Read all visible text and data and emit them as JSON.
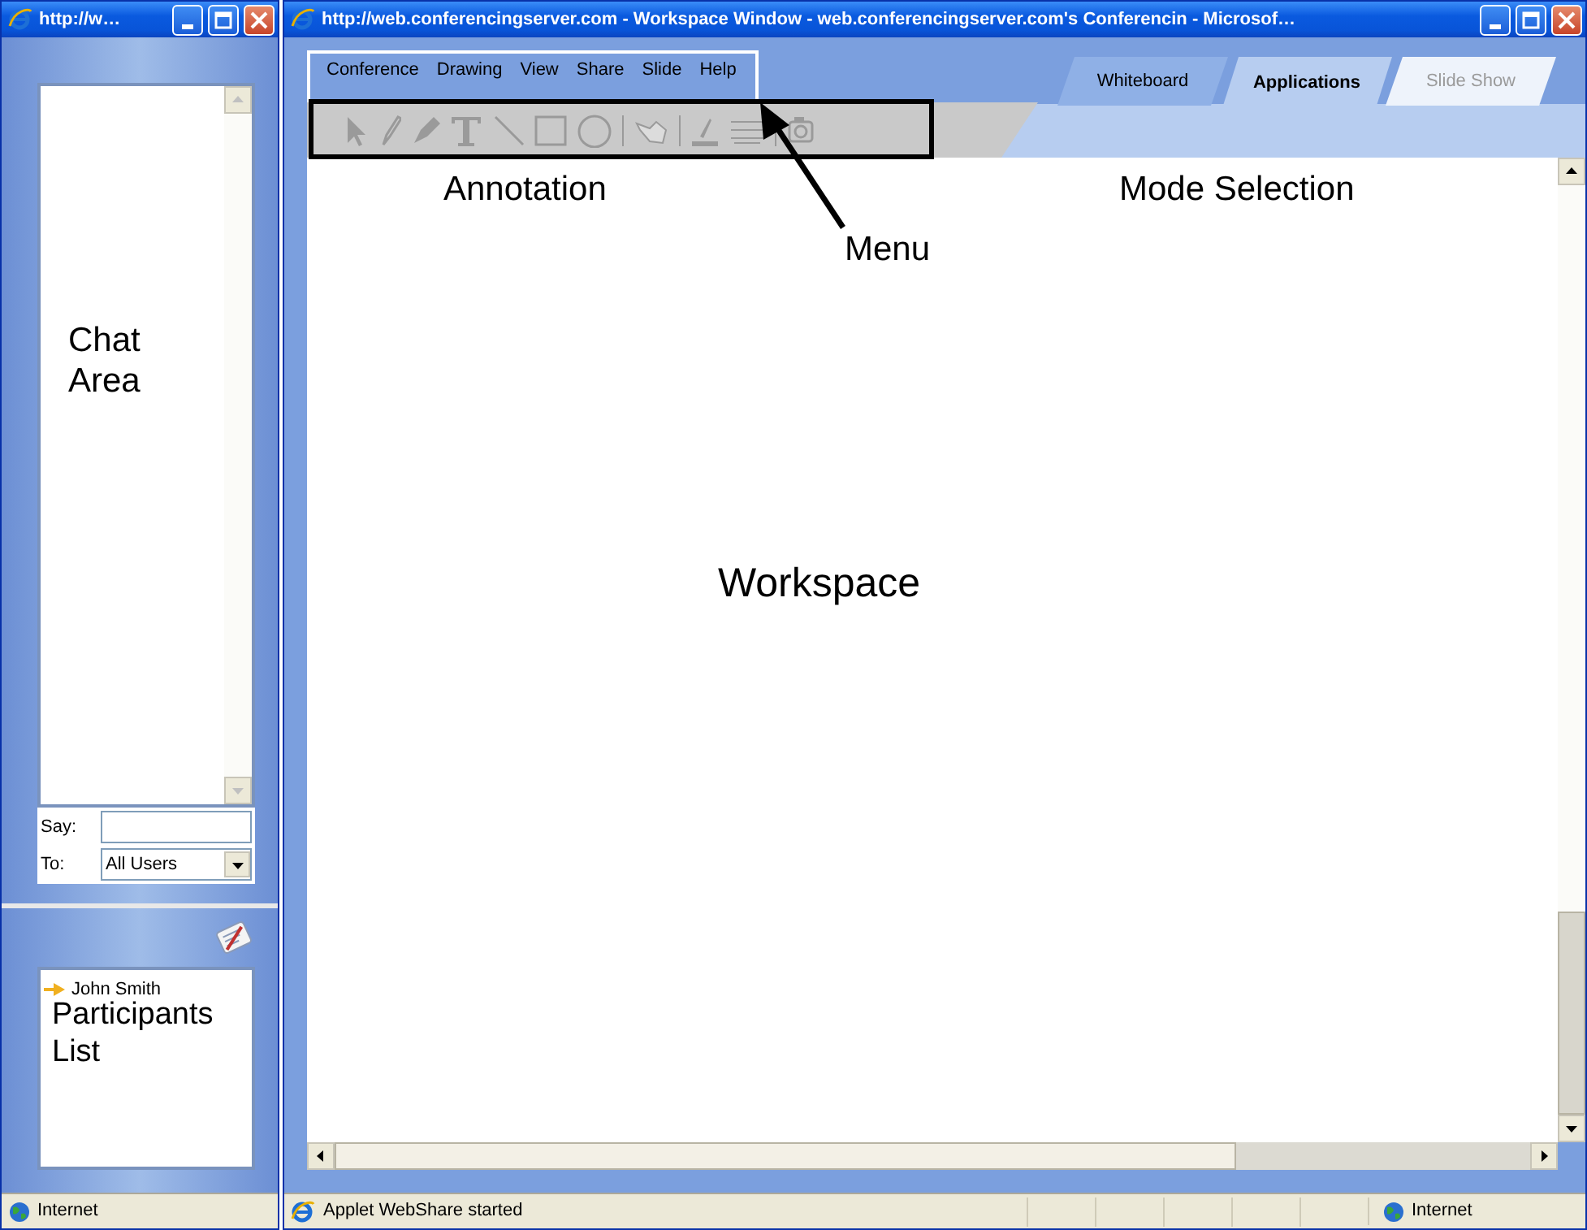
{
  "chat_window": {
    "title": "http://w…",
    "say_label": "Say:",
    "to_label": "To:",
    "to_value": "All Users",
    "participants": [
      {
        "name": "John Smith"
      }
    ],
    "status": "Internet"
  },
  "workspace_window": {
    "title": "http://web.conferencingserver.com - Workspace Window - web.conferencingserver.com's Conferencin - Microsof…",
    "menu": [
      "Conference",
      "Drawing",
      "View",
      "Share",
      "Slide",
      "Help"
    ],
    "tabs": [
      {
        "label": "Whiteboard",
        "selected": false,
        "disabled": false
      },
      {
        "label": "Applications",
        "selected": true,
        "disabled": false
      },
      {
        "label": "Slide Show",
        "selected": false,
        "disabled": true
      }
    ],
    "status": "Applet WebShare started",
    "zone": "Internet"
  },
  "annotations": {
    "chat": "Chat Area",
    "participants": "Participants List",
    "annotation": "Annotation",
    "mode_selection": "Mode Selection",
    "menu": "Menu",
    "workspace": "Workspace"
  }
}
